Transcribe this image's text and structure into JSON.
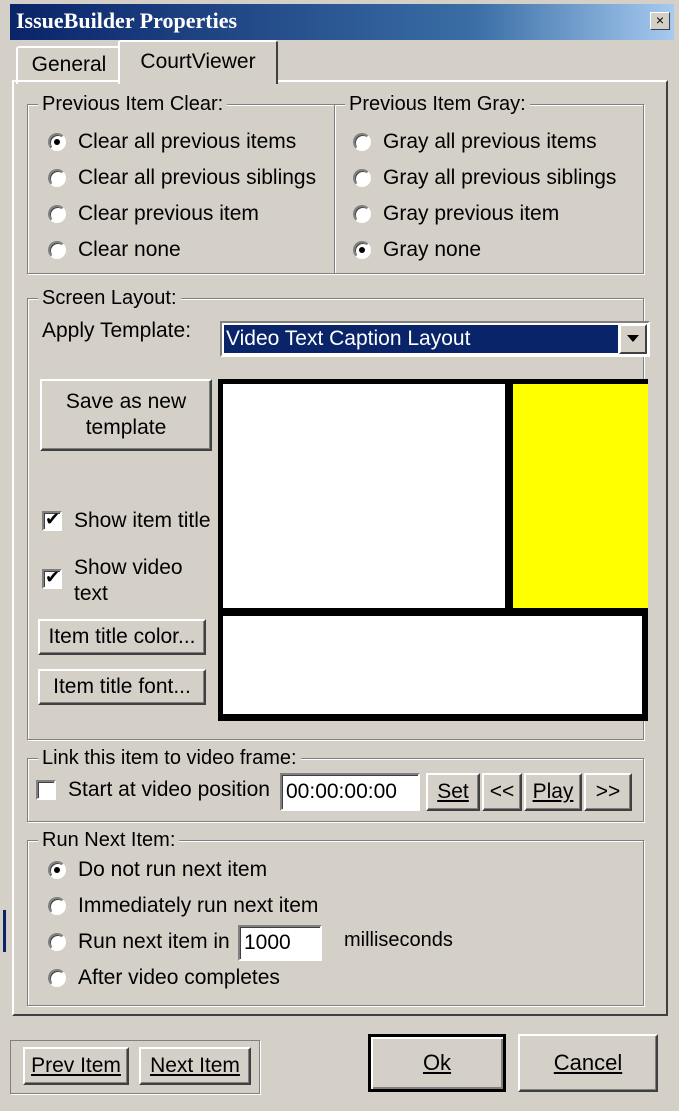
{
  "window": {
    "title": "IssueBuilder Properties",
    "close_glyph": "×"
  },
  "tabs": [
    {
      "label": "General",
      "active": false
    },
    {
      "label": "CourtViewer",
      "active": true
    }
  ],
  "previous_item_clear": {
    "legend": "Previous Item Clear:",
    "options": [
      "Clear all previous items",
      "Clear all previous siblings",
      "Clear previous item",
      "Clear none"
    ],
    "selected_index": 0
  },
  "previous_item_gray": {
    "legend": "Previous Item Gray:",
    "options": [
      "Gray all previous items",
      "Gray all previous siblings",
      "Gray previous item",
      "Gray none"
    ],
    "selected_index": 3
  },
  "screen_layout": {
    "legend": "Screen Layout:",
    "apply_template_label": "Apply Template:",
    "template_value": "Video Text Caption Layout",
    "save_template_label": "Save as new template",
    "show_item_title_label": "Show item title",
    "show_item_title_checked": true,
    "show_video_text_label": "Show video text",
    "show_video_text_checked": true,
    "item_title_color_label": "Item title color...",
    "item_title_font_label": "Item title font...",
    "preview_colors": {
      "caption": "#ffff00",
      "video": "#ffffff",
      "text": "#ffffff",
      "border": "#000000"
    }
  },
  "link_video": {
    "legend": "Link this item to video frame:",
    "start_label": "Start at video position",
    "start_checked": false,
    "position_value": "00:00:00:00",
    "set_label": "Set",
    "rewind_label": "<<",
    "play_label": "Play",
    "forward_label": ">>"
  },
  "run_next": {
    "legend": "Run Next Item:",
    "options": [
      "Do not run next item",
      "Immediately run next item",
      "Run next item in",
      "After video completes"
    ],
    "selected_index": 0,
    "delay_value": "1000",
    "delay_unit": "milliseconds"
  },
  "footer": {
    "prev_label": "Prev Item",
    "next_label": "Next Item",
    "ok_label": "Ok",
    "cancel_label": "Cancel"
  },
  "accent_colors": {
    "title_bar": "#0a246a",
    "selection": "#0a246a",
    "face": "#d4d0c8"
  }
}
